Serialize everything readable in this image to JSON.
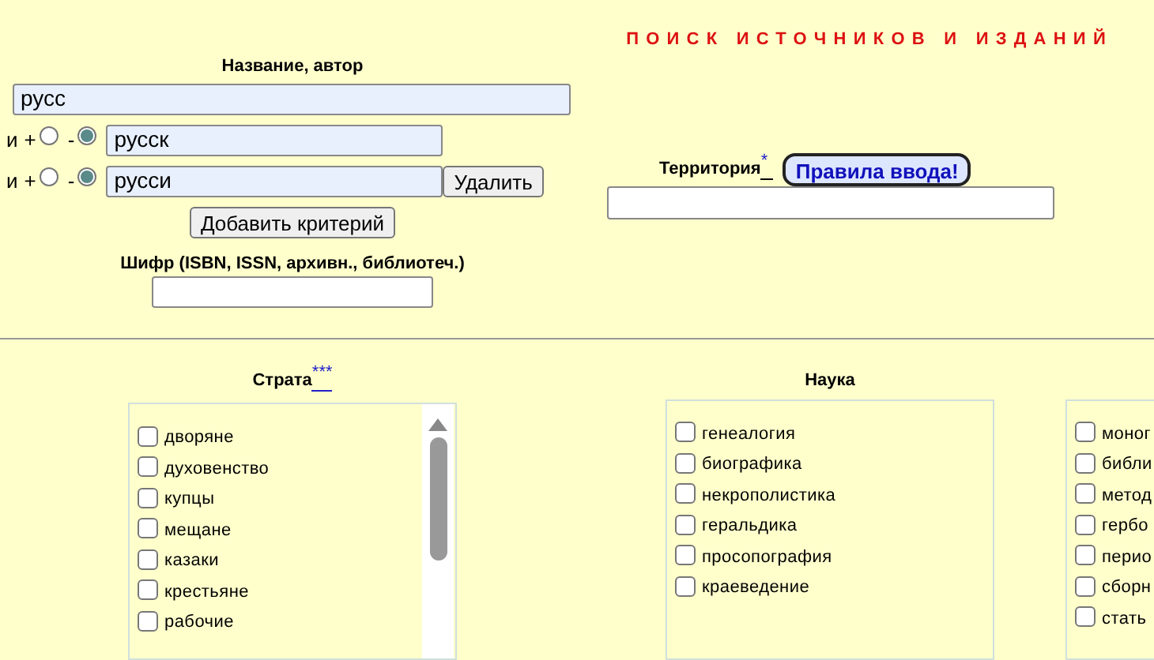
{
  "title": "ПОИСК ИСТОЧНИКОВ И ИЗДАНИЙ",
  "name_author": {
    "label": "Название, автор",
    "value": "русс",
    "criteria": [
      {
        "prefix": "и",
        "radios": [
          {
            "label": "+",
            "selected": false
          },
          {
            "label": "-",
            "selected": true
          }
        ],
        "value": "русск"
      },
      {
        "prefix": "и",
        "radios": [
          {
            "label": "+",
            "selected": false
          },
          {
            "label": "-",
            "selected": true
          }
        ],
        "value": "русси",
        "button": "Удалить"
      }
    ],
    "add_button": "Добавить критерий"
  },
  "cipher": {
    "label": "Шифр (ISBN, ISSN, архивн., библиотеч.)"
  },
  "territory": {
    "label": "Территория",
    "mark": "*",
    "rules_button": "Правила ввода!"
  },
  "lists": [
    {
      "heading": "Страта",
      "mark": "***",
      "scrollbar": true,
      "items": [
        {
          "label": "дворяне",
          "checked": false
        },
        {
          "label": "духовенство",
          "checked": false
        },
        {
          "label": "купцы",
          "checked": false
        },
        {
          "label": "мещане",
          "checked": false
        },
        {
          "label": "казаки",
          "checked": false
        },
        {
          "label": "крестьяне",
          "checked": false
        },
        {
          "label": "рабочие",
          "checked": false
        }
      ]
    },
    {
      "heading": "Наука",
      "items": [
        {
          "label": "генеалогия",
          "checked": false
        },
        {
          "label": "биографика",
          "checked": false
        },
        {
          "label": "некрополистика",
          "checked": false
        },
        {
          "label": "геральдика",
          "checked": false
        },
        {
          "label": "просопография",
          "checked": false
        },
        {
          "label": "краеведение",
          "checked": false
        }
      ]
    },
    {
      "items": [
        {
          "label": "моног",
          "checked": false
        },
        {
          "label": "библи",
          "checked": false
        },
        {
          "label": "метод",
          "checked": false
        },
        {
          "label": "гербо",
          "checked": false
        },
        {
          "label": "перио",
          "checked": false
        },
        {
          "label": "сборн",
          "checked": false
        },
        {
          "label": "стать",
          "checked": false
        }
      ]
    }
  ]
}
